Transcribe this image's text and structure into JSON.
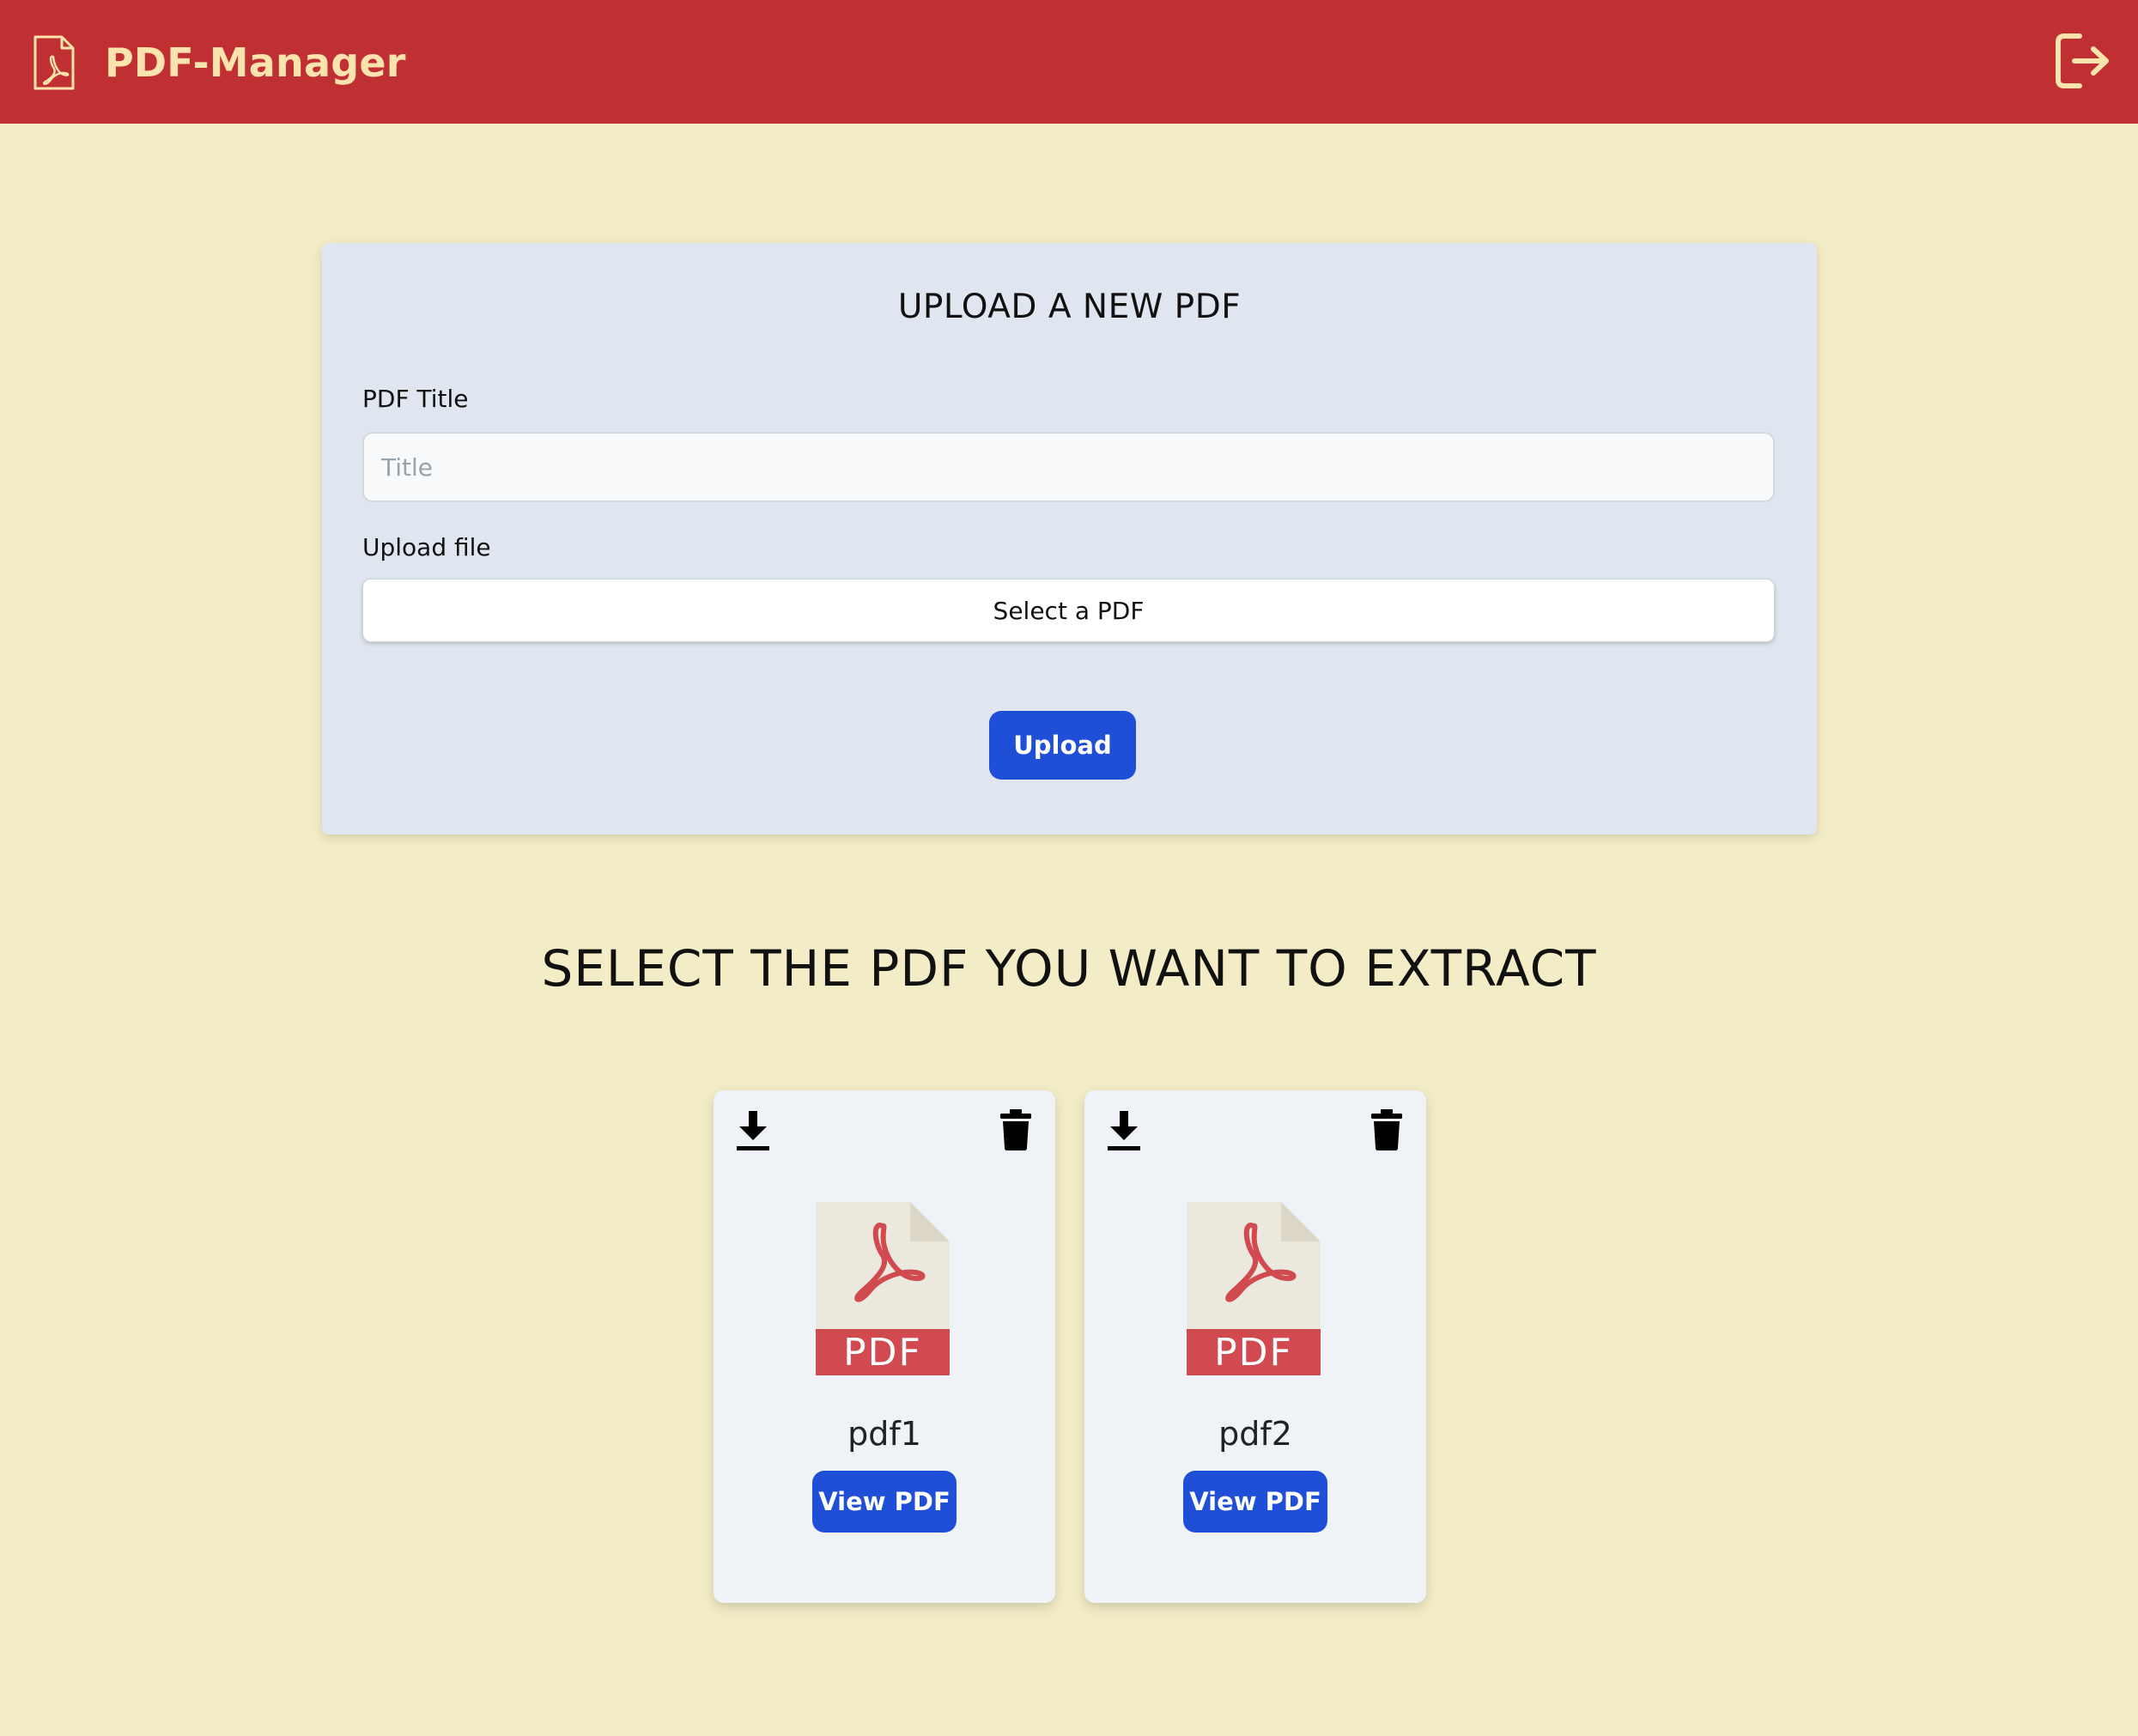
{
  "header": {
    "app_title": "PDF-Manager",
    "logo_icon": "pdf-file-icon",
    "logout_icon": "logout-icon",
    "colors": {
      "bar": "#c03032",
      "text": "#fbe3ad"
    }
  },
  "upload": {
    "heading": "UPLOAD A NEW PDF",
    "title_label": "PDF Title",
    "title_placeholder": "Title",
    "title_value": "",
    "file_label": "Upload file",
    "file_button": "Select a PDF",
    "submit_button": "Upload"
  },
  "library": {
    "heading": "SELECT THE PDF YOU WANT TO EXTRACT",
    "cards": [
      {
        "name": "pdf1",
        "view_label": "View PDF",
        "file_badge": "PDF",
        "download_icon": "download-icon",
        "delete_icon": "trash-icon"
      },
      {
        "name": "pdf2",
        "view_label": "View PDF",
        "file_badge": "PDF",
        "download_icon": "download-icon",
        "delete_icon": "trash-icon"
      }
    ]
  },
  "colors": {
    "page_background": "#f3edc7",
    "panel_background": "#e0e6ef",
    "card_background": "#eff3f7",
    "primary_button": "#1f4fd6"
  }
}
